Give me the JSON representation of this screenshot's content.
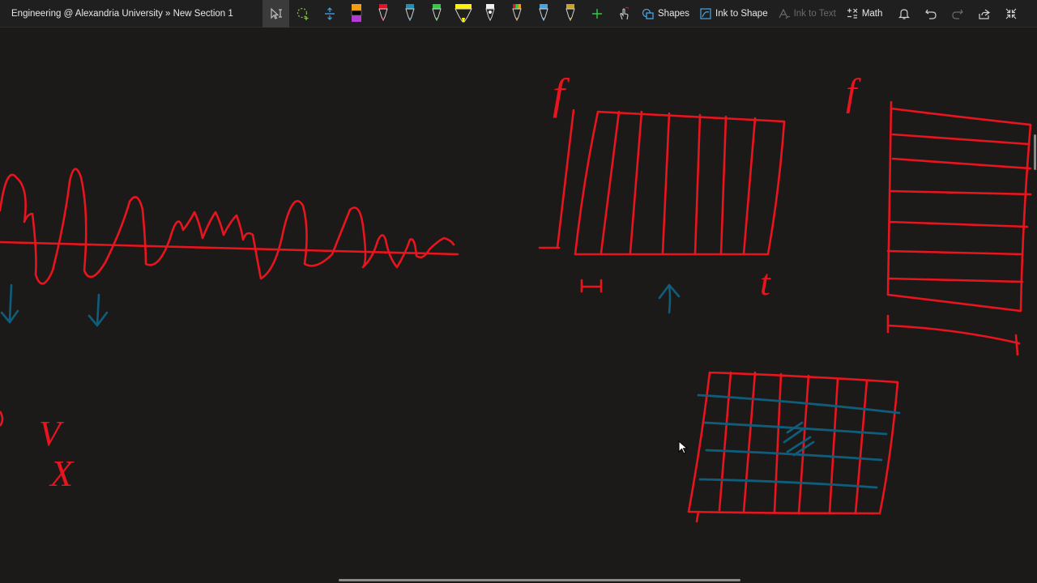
{
  "header": {
    "breadcrumb": "Engineering @ Alexandria University » New Section 1"
  },
  "toolbar": {
    "shapes_label": "Shapes",
    "ink_to_shape_label": "Ink to Shape",
    "ink_to_text_label": "Ink to Text",
    "math_label": "Math",
    "pens": [
      {
        "name": "pen-multicolor",
        "color": "#f39c12"
      },
      {
        "name": "pen-red",
        "color": "#e81123"
      },
      {
        "name": "pen-teal",
        "color": "#1e90b8"
      },
      {
        "name": "pen-green",
        "color": "#2ecc40"
      },
      {
        "name": "highlighter-yellow",
        "color": "#fff100"
      },
      {
        "name": "pen-white",
        "color": "#f0f0f0"
      },
      {
        "name": "pen-rainbow",
        "color": "#e67e22"
      },
      {
        "name": "pen-blue",
        "color": "#4aa3df"
      },
      {
        "name": "pen-gold",
        "color": "#c9a227"
      }
    ]
  },
  "colors": {
    "ink_red": "#e8141e",
    "ink_teal": "#0f5d7a",
    "canvas_bg": "#1b1a19",
    "toolbar_bg": "#1f1f1f"
  },
  "ink_labels": {
    "f_left": "f",
    "f_right": "f",
    "t": "t",
    "v": "V",
    "x": "X"
  }
}
